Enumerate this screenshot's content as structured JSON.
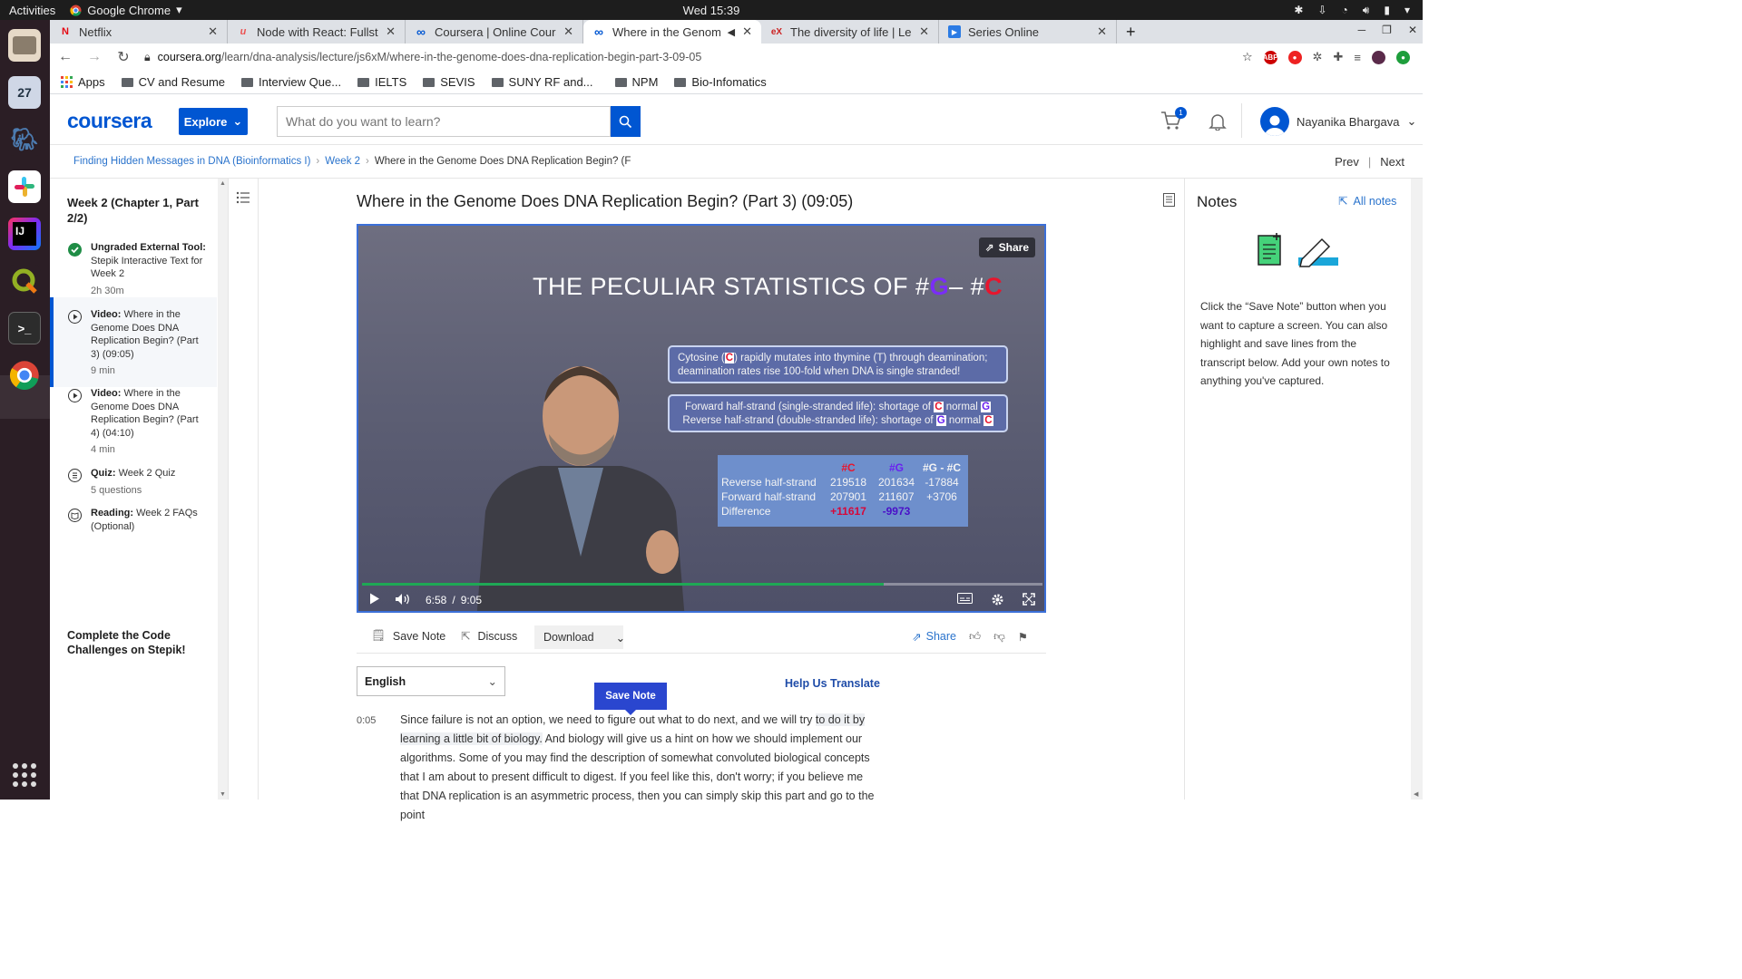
{
  "system": {
    "activities": "Activities",
    "app_name": "Google Chrome",
    "clock": "Wed 15:39",
    "dock_calendar_day": "27",
    "dock_intellij": "IJ"
  },
  "tabs": [
    {
      "title": "Netflix",
      "favicon_color": "#e50914",
      "favicon": "N"
    },
    {
      "title": "Node with React: Fullstac",
      "favicon_color": "#ec5252",
      "favicon": "u"
    },
    {
      "title": "Coursera | Online Courses",
      "favicon_color": "#0056d2",
      "favicon": "∞"
    },
    {
      "title": "Where in the Genome",
      "favicon_color": "#0056d2",
      "favicon": "∞",
      "active": true
    },
    {
      "title": "The diversity of life | Learn",
      "favicon_color": "#c22",
      "favicon": "eX"
    },
    {
      "title": "Series Online",
      "favicon_color": "#2b7be4",
      "favicon": "▶"
    }
  ],
  "address": {
    "host": "coursera.org",
    "path": "/learn/dna-analysis/lecture/js6xM/where-in-the-genome-does-dna-replication-begin-part-3-09-05"
  },
  "bookmarks": {
    "apps": "Apps",
    "items": [
      "CV and Resume",
      "Interview Que...",
      "IELTS",
      "SEVIS",
      "SUNY RF and...",
      "NPM",
      "Bio-Infomatics"
    ]
  },
  "header": {
    "logo": "coursera",
    "explore": "Explore",
    "search_placeholder": "What do you want to learn?",
    "cart_count": "1",
    "user_name": "Nayanika Bhargava"
  },
  "breadcrumb": {
    "course": "Finding Hidden Messages in DNA (Bioinformatics I)",
    "week": "Week 2",
    "current": "Where in the Genome Does DNA Replication Begin? (F",
    "prev": "Prev",
    "next": "Next"
  },
  "sidebar": {
    "week_title": "Week 2 (Chapter 1, Part 2/2)",
    "items": [
      {
        "kind": "Ungraded External Tool:",
        "title": "Stepik Interactive Text for Week 2",
        "meta": "2h 30m"
      },
      {
        "kind": "Video:",
        "title": "Where in the Genome Does DNA Replication Begin? (Part 3) (09:05)",
        "meta": "9 min"
      },
      {
        "kind": "Video:",
        "title": "Where in the Genome Does DNA Replication Begin? (Part 4) (04:10)",
        "meta": "4 min"
      },
      {
        "kind": "Quiz:",
        "title": "Week 2 Quiz",
        "meta": "5 questions"
      },
      {
        "kind": "Reading:",
        "title": "Week 2 FAQs (Optional)",
        "meta": ""
      }
    ],
    "cta": "Complete the Code Challenges on Stepik!"
  },
  "lecture": {
    "title": "Where in the Genome Does DNA Replication Begin? (Part 3) (09:05)"
  },
  "video": {
    "share": "Share",
    "slide_title_prefix": "THE PECULIAR STATISTICS OF #",
    "slide_title_g": "G",
    "slide_title_mid": "– #",
    "slide_title_c": "C",
    "box1_line1_a": "Cytosine (",
    "box1_line1_c": "C",
    "box1_line1_b": ") rapidly mutates into thymine (T) through deamination;",
    "box1_line2": "deamination rates rise 100-fold when DNA is single stranded!",
    "box2_line1_a": "Forward half-strand (single-stranded life):   shortage of",
    "box2_line1_c": "C",
    "box2_line1_b": "normal",
    "box2_line1_g": "G",
    "box2_line2_a": "Reverse half-strand (double-stranded life): shortage of",
    "box2_line2_g": "G",
    "box2_line2_b": "normal",
    "box2_line2_c": "C",
    "table": {
      "header": [
        "",
        "#C",
        "#G",
        "#G - #C"
      ],
      "rows": [
        [
          "Reverse half-strand",
          "219518",
          "201634",
          "-17884"
        ],
        [
          "Forward half-strand",
          "207901",
          "211607",
          "+3706"
        ],
        [
          "Difference",
          "+11617",
          "-9973",
          ""
        ]
      ]
    },
    "current_time": "6:58",
    "time_sep": "/",
    "duration": "9:05",
    "progress_fraction": 0.766
  },
  "actions": {
    "save_note": "Save Note",
    "discuss": "Discuss",
    "download": "Download",
    "share": "Share"
  },
  "transcript": {
    "language": "English",
    "help_translate": "Help Us Translate",
    "save_note_popup": "Save Note",
    "timestamp": "0:05",
    "seg1": "Since failure is not an option, we need to figure out what to do next, and we will try ",
    "seg_hl": "to do it by learning a little bit of biology.",
    "seg2": " And biology will give us a hint on how we should implement our algorithms. Some of you may find the description of somewhat convoluted biological concepts that I am about to present difficult to digest. If you feel like this, don't worry; if you believe me that DNA replication is an asymmetric process, then you can simply skip this part and go to the point"
  },
  "notes": {
    "title": "Notes",
    "all_notes": "All notes",
    "help": "Click the “Save Note” button when you want to capture a screen. You can also highlight and save lines from the transcript below. Add your own notes to anything you've captured."
  }
}
